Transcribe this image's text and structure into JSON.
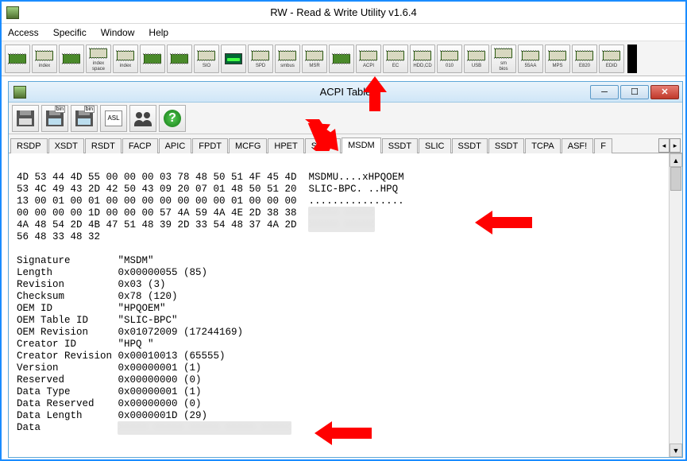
{
  "app": {
    "title": "RW - Read & Write Utility v1.6.4"
  },
  "menu": {
    "items": [
      "Access",
      "Specific",
      "Window",
      "Help"
    ]
  },
  "maintb": [
    {
      "name": "mem-btn",
      "label": ""
    },
    {
      "name": "index-btn",
      "label": "index"
    },
    {
      "name": "mem2-btn",
      "label": ""
    },
    {
      "name": "index-space-btn",
      "label": "index\nspace"
    },
    {
      "name": "index2-btn",
      "label": "index"
    },
    {
      "name": "dev-btn",
      "label": ""
    },
    {
      "name": "dev2-btn",
      "label": ""
    },
    {
      "name": "sio-btn",
      "label": "SIO"
    },
    {
      "name": "lcd-btn",
      "label": ""
    },
    {
      "name": "spd-btn",
      "label": "SPD"
    },
    {
      "name": "smbus-btn",
      "label": "smbus"
    },
    {
      "name": "msr-btn",
      "label": "MSR"
    },
    {
      "name": "cpu-btn",
      "label": ""
    },
    {
      "name": "acpi-btn",
      "label": "ACPI"
    },
    {
      "name": "ec-btn",
      "label": "EC"
    },
    {
      "name": "hdd-btn",
      "label": "HDD,CD"
    },
    {
      "name": "010-btn",
      "label": "010"
    },
    {
      "name": "usb-btn",
      "label": "USB"
    },
    {
      "name": "smbios-btn",
      "label": "sm\nbios"
    },
    {
      "name": "55aa-btn",
      "label": "55AA"
    },
    {
      "name": "mps-btn",
      "label": "MPS"
    },
    {
      "name": "e820-btn",
      "label": "E820"
    },
    {
      "name": "edid-btn",
      "label": "EDID"
    }
  ],
  "child": {
    "title": "ACPI Table",
    "toolbar": [
      {
        "name": "save-floppy-btn"
      },
      {
        "name": "save-bin-btn"
      },
      {
        "name": "save-bin2-btn"
      },
      {
        "name": "asl-btn",
        "text": "ASL"
      },
      {
        "name": "find-btn"
      },
      {
        "name": "help-btn"
      }
    ],
    "tabs": [
      "RSDP",
      "XSDT",
      "RSDT",
      "FACP",
      "APIC",
      "FPDT",
      "MCFG",
      "HPET",
      "SSDT",
      "MSDM",
      "SSDT",
      "SLIC",
      "SSDT",
      "SSDT",
      "TCPA",
      "ASF!",
      "F"
    ],
    "active_tab": 9,
    "hex": {
      "rows": [
        {
          "bytes": "4D 53 44 4D 55 00 00 00 03 78 48 50 51 4F 45 4D",
          "ascii": "MSDMU....xHPQOEM"
        },
        {
          "bytes": "53 4C 49 43 2D 42 50 43 09 20 07 01 48 50 51 20",
          "ascii": "SLIC-BPC. ..HPQ "
        },
        {
          "bytes": "13 00 01 00 01 00 00 00 00 00 00 00 01 00 00 00",
          "ascii": "................"
        },
        {
          "bytes": "00 00 00 00 1D 00 00 00 57 4A 59 4A 4E 2D 38 38",
          "ascii": "XXXXX-XXXXX",
          "blurred": true
        },
        {
          "bytes": "4A 48 54 2D 4B 47 51 48 39 2D 33 54 48 37 4A 2D",
          "ascii": "XXXXX-XXXXX",
          "blurred": true
        },
        {
          "bytes": "56 48 33 48 32",
          "ascii": ""
        }
      ]
    },
    "fields": [
      {
        "k": "Signature",
        "v": "\"MSDM\""
      },
      {
        "k": "Length",
        "v": "0x00000055 (85)"
      },
      {
        "k": "Revision",
        "v": "0x03 (3)"
      },
      {
        "k": "Checksum",
        "v": "0x78 (120)"
      },
      {
        "k": "OEM ID",
        "v": "\"HPQOEM\""
      },
      {
        "k": "OEM Table ID",
        "v": "\"SLIC-BPC\""
      },
      {
        "k": "OEM Revision",
        "v": "0x01072009 (17244169)"
      },
      {
        "k": "Creator ID",
        "v": "\"HPQ \""
      },
      {
        "k": "Creator Revision",
        "v": "0x00010013 (65555)"
      },
      {
        "k": "Version",
        "v": "0x00000001 (1)"
      },
      {
        "k": "Reserved",
        "v": "0x00000000 (0)"
      },
      {
        "k": "Data Type",
        "v": "0x00000001 (1)"
      },
      {
        "k": "Data Reserved",
        "v": "0x00000000 (0)"
      },
      {
        "k": "Data Length",
        "v": "0x0000001D (29)"
      },
      {
        "k": "Data",
        "v": "XXXXX-XXXXX-XXXXX-XXXXX-XXXXX",
        "blurred": true
      }
    ]
  }
}
